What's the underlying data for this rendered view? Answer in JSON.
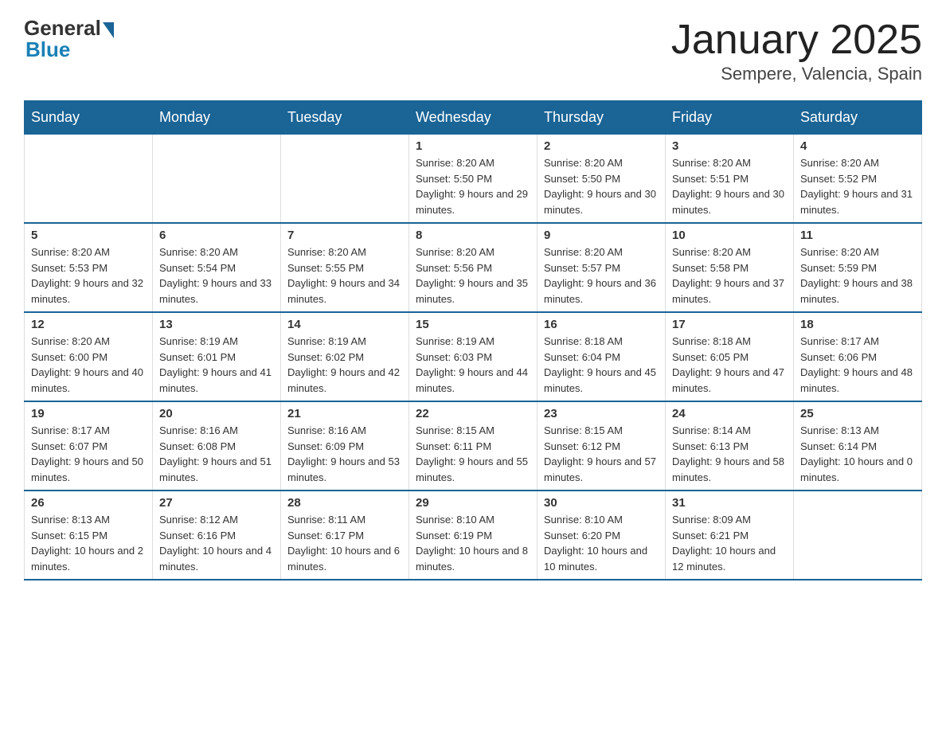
{
  "header": {
    "logo_text_general": "General",
    "logo_text_blue": "Blue",
    "calendar_title": "January 2025",
    "calendar_subtitle": "Sempere, Valencia, Spain"
  },
  "days_of_week": [
    "Sunday",
    "Monday",
    "Tuesday",
    "Wednesday",
    "Thursday",
    "Friday",
    "Saturday"
  ],
  "weeks": [
    [
      {
        "day": "",
        "info": ""
      },
      {
        "day": "",
        "info": ""
      },
      {
        "day": "",
        "info": ""
      },
      {
        "day": "1",
        "info": "Sunrise: 8:20 AM\nSunset: 5:50 PM\nDaylight: 9 hours and 29 minutes."
      },
      {
        "day": "2",
        "info": "Sunrise: 8:20 AM\nSunset: 5:50 PM\nDaylight: 9 hours and 30 minutes."
      },
      {
        "day": "3",
        "info": "Sunrise: 8:20 AM\nSunset: 5:51 PM\nDaylight: 9 hours and 30 minutes."
      },
      {
        "day": "4",
        "info": "Sunrise: 8:20 AM\nSunset: 5:52 PM\nDaylight: 9 hours and 31 minutes."
      }
    ],
    [
      {
        "day": "5",
        "info": "Sunrise: 8:20 AM\nSunset: 5:53 PM\nDaylight: 9 hours and 32 minutes."
      },
      {
        "day": "6",
        "info": "Sunrise: 8:20 AM\nSunset: 5:54 PM\nDaylight: 9 hours and 33 minutes."
      },
      {
        "day": "7",
        "info": "Sunrise: 8:20 AM\nSunset: 5:55 PM\nDaylight: 9 hours and 34 minutes."
      },
      {
        "day": "8",
        "info": "Sunrise: 8:20 AM\nSunset: 5:56 PM\nDaylight: 9 hours and 35 minutes."
      },
      {
        "day": "9",
        "info": "Sunrise: 8:20 AM\nSunset: 5:57 PM\nDaylight: 9 hours and 36 minutes."
      },
      {
        "day": "10",
        "info": "Sunrise: 8:20 AM\nSunset: 5:58 PM\nDaylight: 9 hours and 37 minutes."
      },
      {
        "day": "11",
        "info": "Sunrise: 8:20 AM\nSunset: 5:59 PM\nDaylight: 9 hours and 38 minutes."
      }
    ],
    [
      {
        "day": "12",
        "info": "Sunrise: 8:20 AM\nSunset: 6:00 PM\nDaylight: 9 hours and 40 minutes."
      },
      {
        "day": "13",
        "info": "Sunrise: 8:19 AM\nSunset: 6:01 PM\nDaylight: 9 hours and 41 minutes."
      },
      {
        "day": "14",
        "info": "Sunrise: 8:19 AM\nSunset: 6:02 PM\nDaylight: 9 hours and 42 minutes."
      },
      {
        "day": "15",
        "info": "Sunrise: 8:19 AM\nSunset: 6:03 PM\nDaylight: 9 hours and 44 minutes."
      },
      {
        "day": "16",
        "info": "Sunrise: 8:18 AM\nSunset: 6:04 PM\nDaylight: 9 hours and 45 minutes."
      },
      {
        "day": "17",
        "info": "Sunrise: 8:18 AM\nSunset: 6:05 PM\nDaylight: 9 hours and 47 minutes."
      },
      {
        "day": "18",
        "info": "Sunrise: 8:17 AM\nSunset: 6:06 PM\nDaylight: 9 hours and 48 minutes."
      }
    ],
    [
      {
        "day": "19",
        "info": "Sunrise: 8:17 AM\nSunset: 6:07 PM\nDaylight: 9 hours and 50 minutes."
      },
      {
        "day": "20",
        "info": "Sunrise: 8:16 AM\nSunset: 6:08 PM\nDaylight: 9 hours and 51 minutes."
      },
      {
        "day": "21",
        "info": "Sunrise: 8:16 AM\nSunset: 6:09 PM\nDaylight: 9 hours and 53 minutes."
      },
      {
        "day": "22",
        "info": "Sunrise: 8:15 AM\nSunset: 6:11 PM\nDaylight: 9 hours and 55 minutes."
      },
      {
        "day": "23",
        "info": "Sunrise: 8:15 AM\nSunset: 6:12 PM\nDaylight: 9 hours and 57 minutes."
      },
      {
        "day": "24",
        "info": "Sunrise: 8:14 AM\nSunset: 6:13 PM\nDaylight: 9 hours and 58 minutes."
      },
      {
        "day": "25",
        "info": "Sunrise: 8:13 AM\nSunset: 6:14 PM\nDaylight: 10 hours and 0 minutes."
      }
    ],
    [
      {
        "day": "26",
        "info": "Sunrise: 8:13 AM\nSunset: 6:15 PM\nDaylight: 10 hours and 2 minutes."
      },
      {
        "day": "27",
        "info": "Sunrise: 8:12 AM\nSunset: 6:16 PM\nDaylight: 10 hours and 4 minutes."
      },
      {
        "day": "28",
        "info": "Sunrise: 8:11 AM\nSunset: 6:17 PM\nDaylight: 10 hours and 6 minutes."
      },
      {
        "day": "29",
        "info": "Sunrise: 8:10 AM\nSunset: 6:19 PM\nDaylight: 10 hours and 8 minutes."
      },
      {
        "day": "30",
        "info": "Sunrise: 8:10 AM\nSunset: 6:20 PM\nDaylight: 10 hours and 10 minutes."
      },
      {
        "day": "31",
        "info": "Sunrise: 8:09 AM\nSunset: 6:21 PM\nDaylight: 10 hours and 12 minutes."
      },
      {
        "day": "",
        "info": ""
      }
    ]
  ]
}
